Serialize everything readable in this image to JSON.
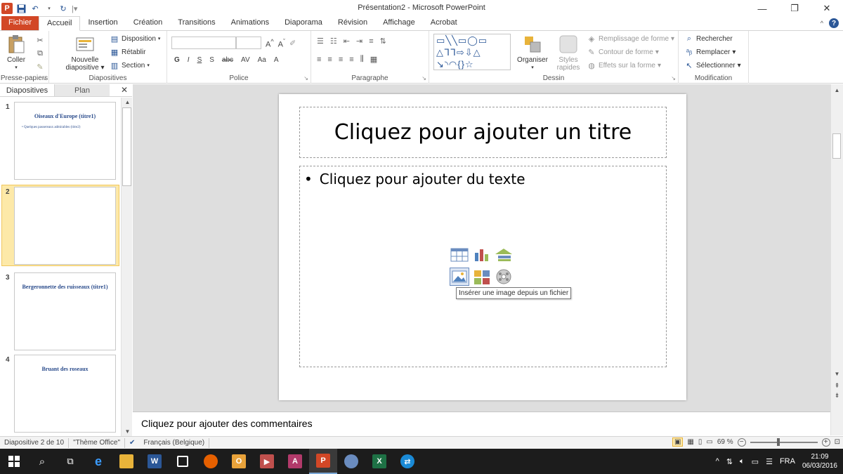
{
  "window": {
    "title": "Présentation2 - Microsoft PowerPoint",
    "app_icon_letter": "P",
    "controls": {
      "minimize": "—",
      "restore": "❐",
      "close": "✕"
    }
  },
  "tabs": [
    "Fichier",
    "Accueil",
    "Insertion",
    "Création",
    "Transitions",
    "Animations",
    "Diaporama",
    "Révision",
    "Affichage",
    "Acrobat"
  ],
  "active_tab": "Accueil",
  "ribbon": {
    "clipboard": {
      "label": "Presse-papiers",
      "coller": "Coller"
    },
    "slides": {
      "label": "Diapositives",
      "new_slide": "Nouvelle diapositive",
      "new_slide_line1": "Nouvelle",
      "new_slide_line2": "diapositive",
      "disposition": "Disposition",
      "retablir": "Rétablir",
      "section": "Section"
    },
    "font": {
      "label": "Police"
    },
    "paragraph": {
      "label": "Paragraphe"
    },
    "drawing": {
      "label": "Dessin",
      "organiser": "Organiser",
      "styles_line1": "Styles",
      "styles_line2": "rapides",
      "remplissage": "Remplissage de forme",
      "contour": "Contour de forme",
      "effets": "Effets sur la forme"
    },
    "editing": {
      "label": "Modification",
      "rechercher": "Rechercher",
      "remplacer": "Remplacer",
      "selectionner": "Sélectionner"
    }
  },
  "pane": {
    "tab_slides": "Diapositives",
    "tab_outline": "Plan",
    "close": "✕",
    "slides": [
      {
        "num": "1",
        "title": "Oiseaux d'Europe (titre1)",
        "sub": "•  Quelques passereaux admirables (titre2)"
      },
      {
        "num": "2",
        "title": "",
        "sub": ""
      },
      {
        "num": "3",
        "title": "Bergeronnette des ruisseaux (titre1)",
        "sub": ""
      },
      {
        "num": "4",
        "title": "Bruant des roseaux",
        "sub": ""
      }
    ],
    "selected": 2
  },
  "slide": {
    "title_placeholder": "Cliquez pour ajouter un titre",
    "body_placeholder": "Cliquez pour ajouter du texte",
    "bullet": "•",
    "tooltip": "Insérer une image depuis un fichier"
  },
  "notes": {
    "placeholder": "Cliquez pour ajouter des commentaires"
  },
  "status": {
    "slide_pos": "Diapositive 2 de 10",
    "theme": "\"Thème Office\"",
    "language": "Français (Belgique)",
    "zoom": "69 %",
    "zoom_level": 0.42
  },
  "taskbar": {
    "tray_lang": "FRA",
    "time": "21:09",
    "date": "06/03/2016"
  },
  "colors": {
    "accent": "#d24726",
    "ribbon_blue": "#2b5797",
    "selected_thumb": "#fde9a8"
  }
}
